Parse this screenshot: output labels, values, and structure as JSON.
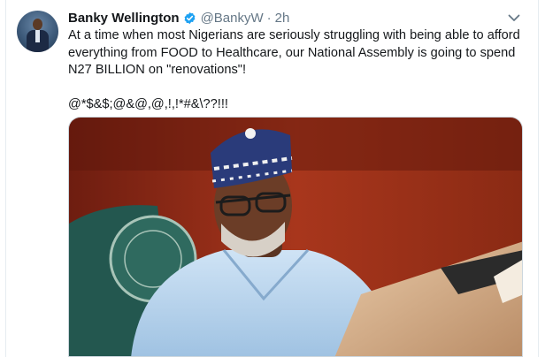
{
  "tweet": {
    "author_name": "Banky Wellington",
    "handle": "@BankyW",
    "separator": "·",
    "time": "2h",
    "text_line1": "At a time when most Nigerians are seriously struggling with being able to afford",
    "text_line2": "everything from FOOD to Healthcare, our National Assembly is going to spend",
    "text_line3": "N27 BILLION on \"renovations\"!",
    "text_line4": "@*$&$;@&@,@,!,!*#&\\??!!!",
    "verified_icon": "verified-badge-icon",
    "menu_icon": "chevron-down-icon",
    "accent_color": "#1da1f2",
    "text_color": "#14171a",
    "muted_color": "#657786"
  },
  "media": {
    "description_icon": "photo"
  }
}
